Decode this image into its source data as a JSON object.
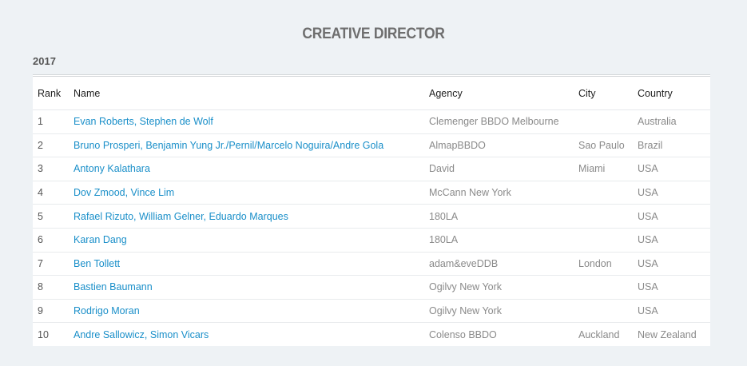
{
  "page": {
    "title": "CREATIVE DIRECTOR",
    "year": "2017"
  },
  "table": {
    "headers": {
      "rank": "Rank",
      "name": "Name",
      "agency": "Agency",
      "city": "City",
      "country": "Country"
    },
    "rows": [
      {
        "rank": "1",
        "name": "Evan Roberts, Stephen de Wolf",
        "agency": "Clemenger BBDO Melbourne",
        "city": "",
        "country": "Australia"
      },
      {
        "rank": "2",
        "name": "Bruno Prosperi, Benjamin Yung Jr./Pernil/Marcelo Noguira/Andre Gola",
        "agency": "AlmapBBDO",
        "city": "Sao Paulo",
        "country": "Brazil"
      },
      {
        "rank": "3",
        "name": "Antony Kalathara",
        "agency": "David",
        "city": "Miami",
        "country": "USA"
      },
      {
        "rank": "4",
        "name": "Dov Zmood, Vince Lim",
        "agency": "McCann New York",
        "city": "",
        "country": "USA"
      },
      {
        "rank": "5",
        "name": "Rafael Rizuto, William Gelner, Eduardo Marques",
        "agency": "180LA",
        "city": "",
        "country": "USA"
      },
      {
        "rank": "6",
        "name": "Karan Dang",
        "agency": "180LA",
        "city": "",
        "country": "USA"
      },
      {
        "rank": "7",
        "name": "Ben Tollett",
        "agency": "adam&eveDDB",
        "city": "London",
        "country": "USA"
      },
      {
        "rank": "8",
        "name": "Bastien Baumann",
        "agency": "Ogilvy New York",
        "city": "",
        "country": "USA"
      },
      {
        "rank": "9",
        "name": "Rodrigo Moran",
        "agency": "Ogilvy New York",
        "city": "",
        "country": "USA"
      },
      {
        "rank": "10",
        "name": "Andre Sallowicz, Simon Vicars",
        "agency": "Colenso BBDO",
        "city": "Auckland",
        "country": "New Zealand"
      }
    ]
  },
  "colors": {
    "background": "#eef2f5",
    "link": "#1a8fc9",
    "title": "#6e6e6e"
  }
}
